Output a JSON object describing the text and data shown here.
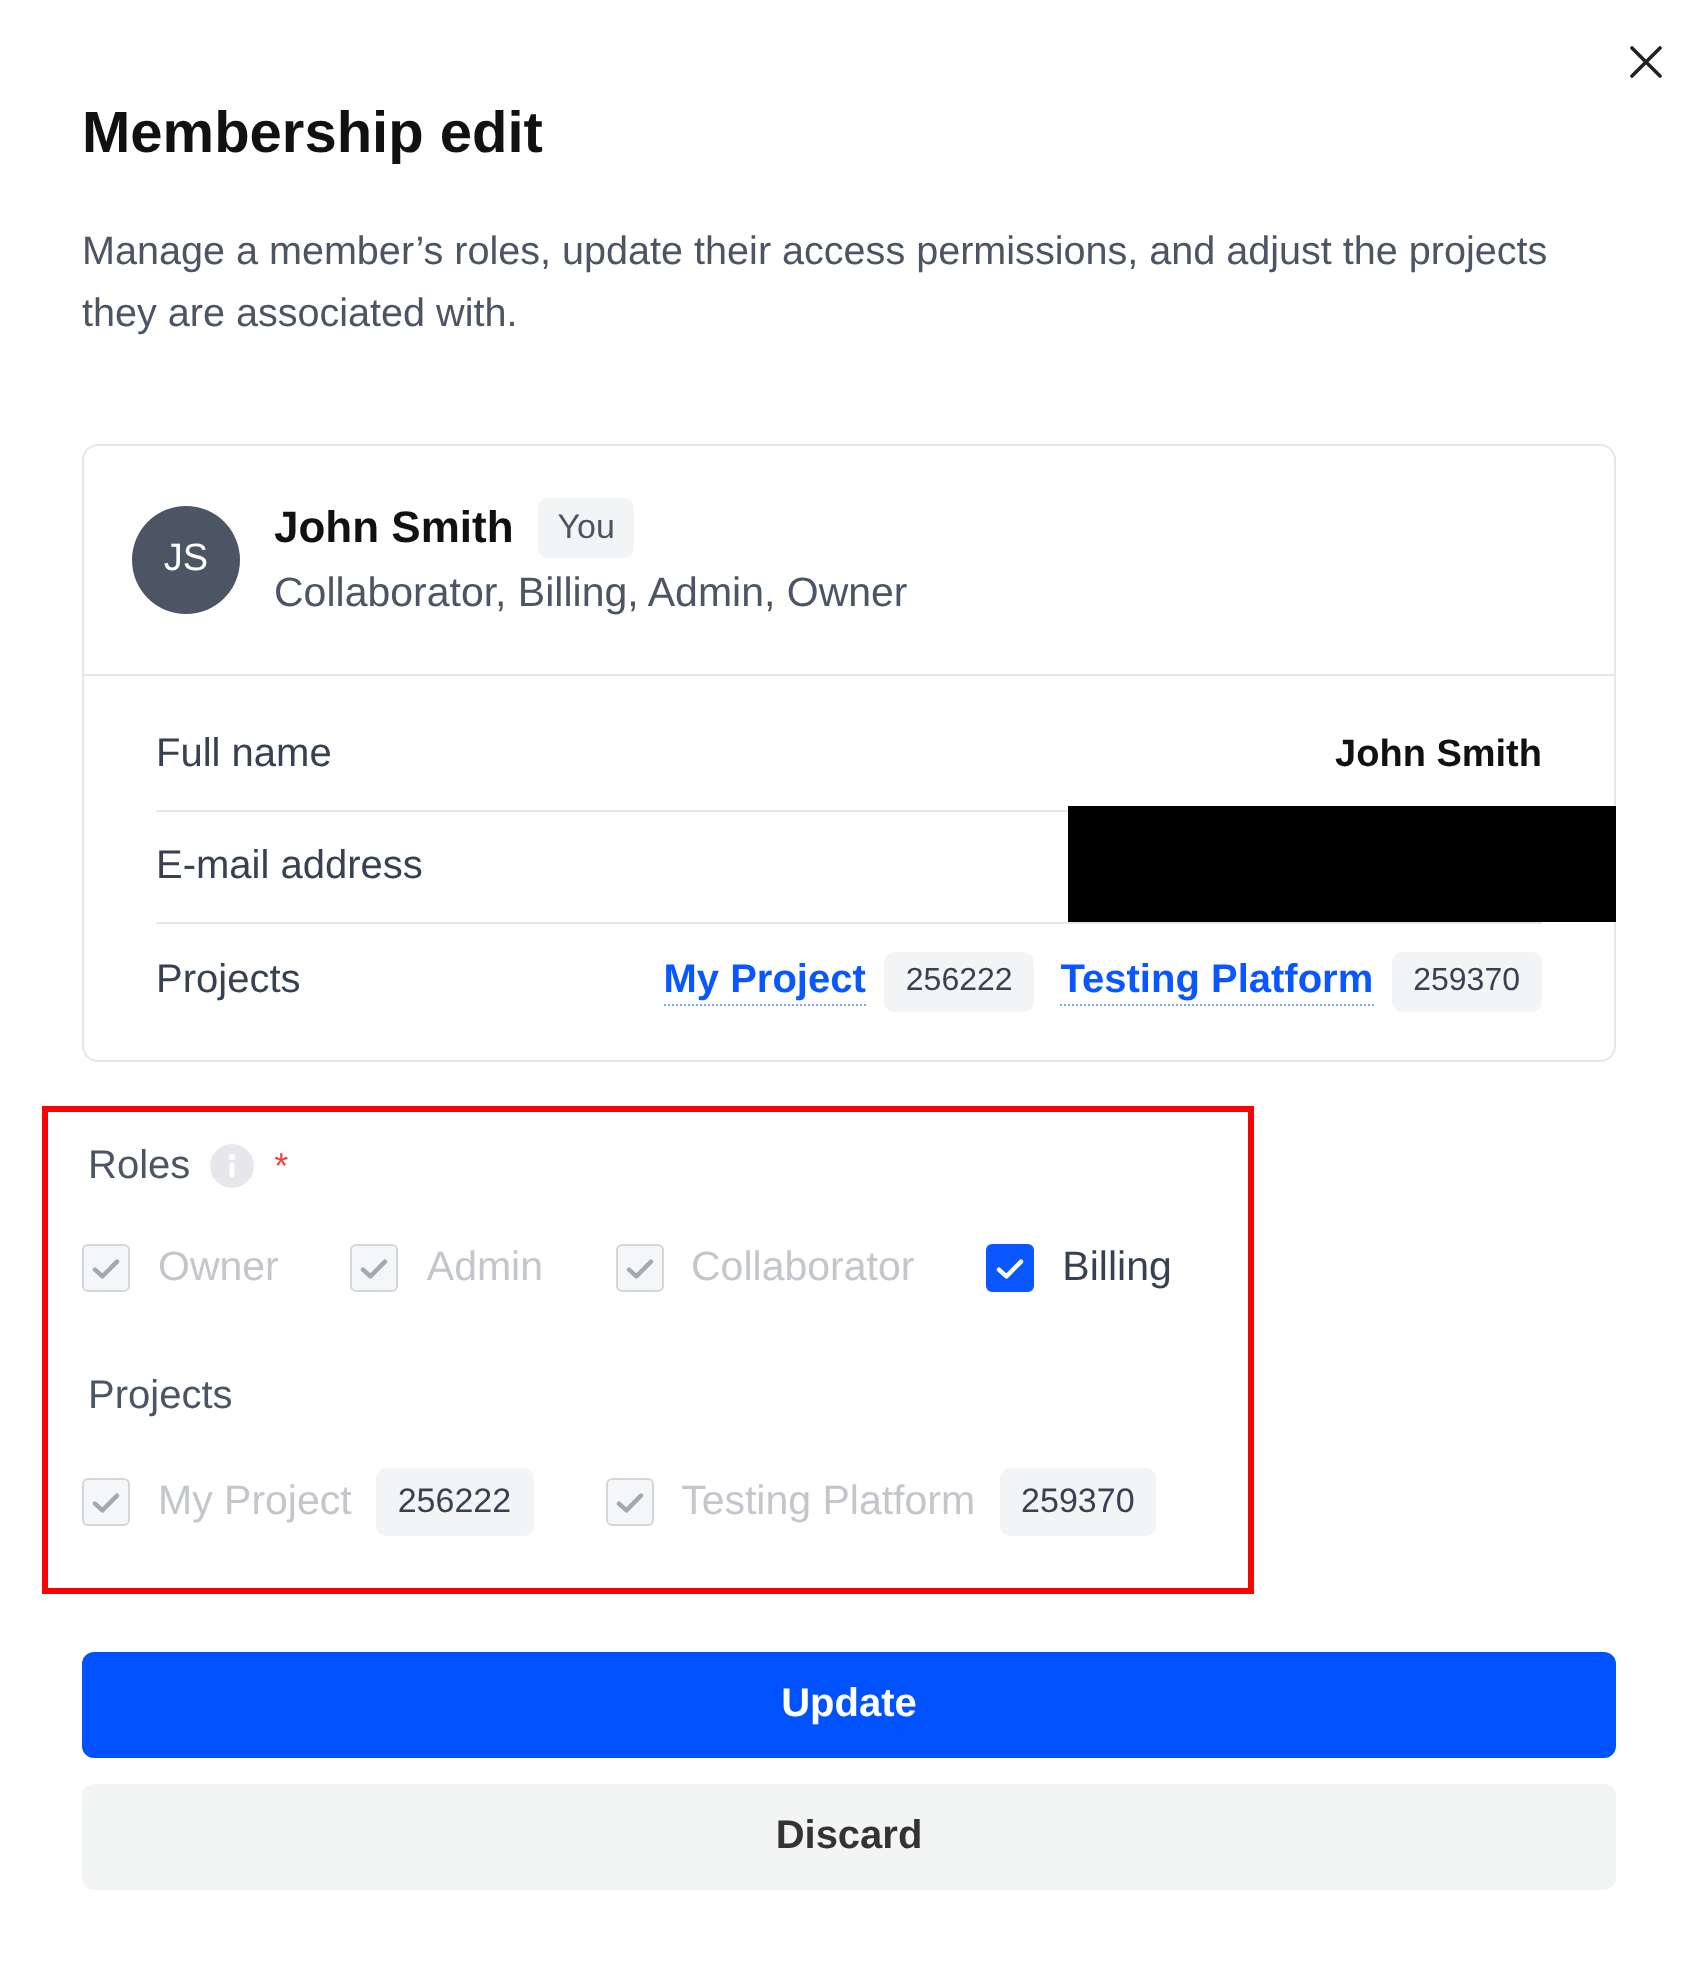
{
  "dialog": {
    "title": "Membership edit",
    "description": "Manage a member’s roles, update their access permissions, and adjust the projects they are associated with."
  },
  "member": {
    "initials": "JS",
    "name": "John Smith",
    "badge": "You",
    "roles_summary": "Collaborator, Billing, Admin, Owner"
  },
  "details": [
    {
      "kind": "text",
      "label": "Full name",
      "value": "John Smith"
    },
    {
      "kind": "redacted",
      "label": "E-mail address"
    },
    {
      "kind": "projects",
      "label": "Projects",
      "projects": [
        {
          "name": "My Project",
          "id": "256222"
        },
        {
          "name": "Testing Platform",
          "id": "259370"
        }
      ]
    }
  ],
  "form": {
    "highlighted": true,
    "roles": {
      "label": "Roles",
      "required_mark": "*",
      "options": [
        {
          "label": "Owner",
          "checked": true,
          "disabled": true
        },
        {
          "label": "Admin",
          "checked": true,
          "disabled": true
        },
        {
          "label": "Collaborator",
          "checked": true,
          "disabled": true
        },
        {
          "label": "Billing",
          "checked": true,
          "disabled": false
        }
      ]
    },
    "projects": {
      "label": "Projects",
      "options": [
        {
          "label": "My Project",
          "id": "256222",
          "checked": true,
          "disabled": true
        },
        {
          "label": "Testing Platform",
          "id": "259370",
          "checked": true,
          "disabled": true
        }
      ]
    }
  },
  "buttons": [
    {
      "kind": "primary",
      "label": "Update"
    },
    {
      "kind": "secondary",
      "label": "Discard"
    }
  ]
}
